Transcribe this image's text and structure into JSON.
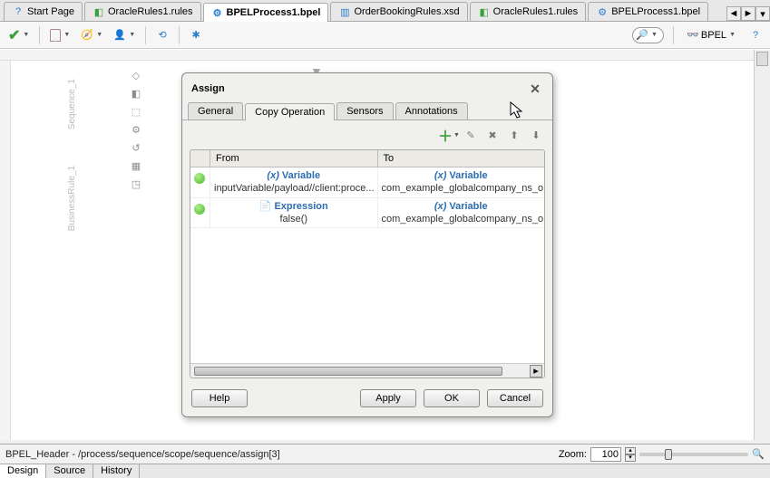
{
  "top_tabs": {
    "items": [
      {
        "label": "Start Page",
        "icon": "help-icon"
      },
      {
        "label": "OracleRules1.rules",
        "icon": "rules-icon"
      },
      {
        "label": "BPELProcess1.bpel",
        "icon": "bpel-icon",
        "active": true
      },
      {
        "label": "OrderBookingRules.xsd",
        "icon": "xsd-icon"
      },
      {
        "label": "OracleRules1.rules",
        "icon": "rules-icon"
      },
      {
        "label": "BPELProcess1.bpel",
        "icon": "bpel-icon"
      }
    ]
  },
  "toolbar": {
    "view_mode": "BPEL"
  },
  "sidebar_labels": [
    "Sequence_1",
    "BusinessRule_1"
  ],
  "dialog": {
    "title": "Assign",
    "tabs": [
      "General",
      "Copy Operation",
      "Sensors",
      "Annotations"
    ],
    "active_tab": 1,
    "columns": {
      "dot": "",
      "from": "From",
      "to": "To"
    },
    "rows": [
      {
        "from_type": "Variable",
        "from_val": "inputVariable/payload//client:proce...",
        "to_type": "Variable",
        "to_val": "com_example_globalcompany_ns_o"
      },
      {
        "from_type": "Expression",
        "from_val": "false()",
        "to_type": "Variable",
        "to_val": "com_example_globalcompany_ns_o"
      }
    ],
    "buttons": {
      "help": "Help",
      "apply": "Apply",
      "ok": "OK",
      "cancel": "Cancel"
    }
  },
  "status": {
    "path": "BPEL_Header - /process/sequence/scope/sequence/assign[3]",
    "zoom_label": "Zoom:",
    "zoom_value": "100"
  },
  "bottom_tabs": [
    "Design",
    "Source",
    "History"
  ]
}
